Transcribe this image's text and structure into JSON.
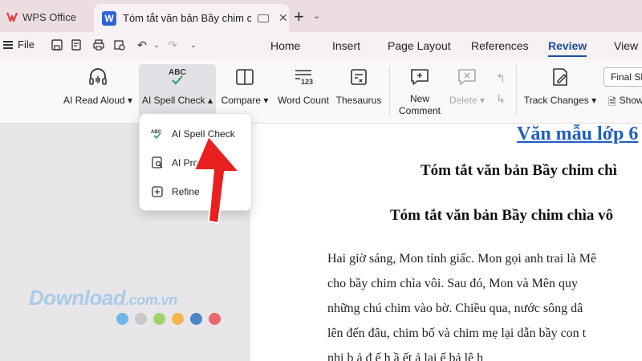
{
  "tabs": {
    "wps": "WPS Office",
    "doc": "Tóm tắt văn bản Bầy chim chìa vôi",
    "brand_color": "#e63b3b",
    "doc_badge": "W"
  },
  "menubar": {
    "file": "File",
    "tabs": [
      "Home",
      "Insert",
      "Page Layout",
      "References",
      "Review",
      "View"
    ],
    "active": "Review"
  },
  "ribbon": {
    "read_aloud": "AI Read Aloud",
    "spell_check": "AI Spell Check",
    "spell_icon_text": "ABC",
    "compare": "Compare",
    "word_count": "Word Count",
    "word_count_icon_text": "123",
    "thesaurus": "Thesaurus",
    "new_comment_1": "New",
    "new_comment_2": "Comment",
    "delete": "Delete",
    "track_changes": "Track Changes",
    "final_select": "Final Sh",
    "show": "Show"
  },
  "dropdown": {
    "items": [
      {
        "label": "AI Spell Check",
        "icon": "abc-check-icon"
      },
      {
        "label": "AI Pro",
        "icon": "ai-proofread-icon"
      },
      {
        "label": "Refine",
        "icon": "refine-icon"
      }
    ]
  },
  "document": {
    "link": "Văn mẫu lớp 6",
    "heading1": "Tóm tắt văn bản Bầy chim chì",
    "heading2": "Tóm tắt văn bản Bầy chim chìa vô",
    "lines": [
      "Hai giờ sáng, Mon tỉnh giấc. Mon gọi anh trai là Mê",
      "cho bầy chim chìa vôi. Sau đó, Mon và Mên quy",
      "những chú chim vào bờ. Chiều qua, nước sông dâ",
      "lên đến đâu, chim bố và chim mẹ lại dẫn bầy con t",
      "nhi   b ả đ ế   h ầ           ết ả  lại ế  bả  lê  h"
    ]
  },
  "watermark": {
    "text": "Download",
    "suffix": ".com.vn",
    "dot_colors": [
      "#6fb6e6",
      "#c8c8c8",
      "#9fd36a",
      "#f2b64b",
      "#4a86c8",
      "#e86a6a"
    ]
  }
}
